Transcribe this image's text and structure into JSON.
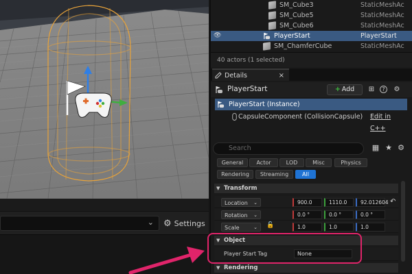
{
  "outliner": {
    "rows": [
      {
        "name": "SM_Cube3",
        "type": "StaticMeshAc",
        "selected": false
      },
      {
        "name": "SM_Cube5",
        "type": "StaticMeshAc",
        "selected": false
      },
      {
        "name": "SM_Cube6",
        "type": "StaticMeshAc",
        "selected": false
      },
      {
        "name": "PlayerStart",
        "type": "PlayerStart",
        "selected": true
      },
      {
        "name": "SM_ChamferCube",
        "type": "StaticMeshAc",
        "selected": false
      }
    ],
    "actor_count": "40 actors (1 selected)"
  },
  "details": {
    "tab_label": "Details",
    "close_glyph": "×",
    "actor_name": "PlayerStart",
    "add_label": "Add",
    "add_glyph": "+",
    "instance_label": "PlayerStart (Instance)",
    "component_label": "CapsuleComponent (CollisionCapsule)",
    "edit_cpp": "Edit in C++",
    "search_placeholder": "Search",
    "filters": [
      "General",
      "Actor",
      "LOD",
      "Misc",
      "Physics",
      "Rendering",
      "Streaming",
      "All"
    ],
    "active_filter": "All"
  },
  "transform": {
    "title": "Transform",
    "location_label": "Location",
    "rotation_label": "Rotation",
    "scale_label": "Scale",
    "location": [
      "900.0",
      "1110.0",
      "92.012604"
    ],
    "rotation": [
      "0.0 °",
      "0.0 °",
      "0.0 °"
    ],
    "scale": [
      "1.0",
      "1.0",
      "1.0"
    ]
  },
  "object": {
    "title": "Object",
    "player_start_tag_label": "Player Start Tag",
    "player_start_tag_value": "None"
  },
  "next_section": {
    "title": "Rendering"
  },
  "viewport_bar": {
    "settings_label": "Settings",
    "chevron": "⌄"
  },
  "glyphs": {
    "eye": "👁",
    "collapse": "▼",
    "gear": "⚙",
    "help": "?",
    "grid": "▦",
    "star": "★",
    "chevron_small": "⌄",
    "reset": "↶",
    "lock": "🔓",
    "bp": "⊞"
  },
  "colors": {
    "selection": "#3a5a82",
    "highlight": "#e0246a",
    "active_filter": "#1f73d4",
    "capsule": "#e8a33a"
  }
}
